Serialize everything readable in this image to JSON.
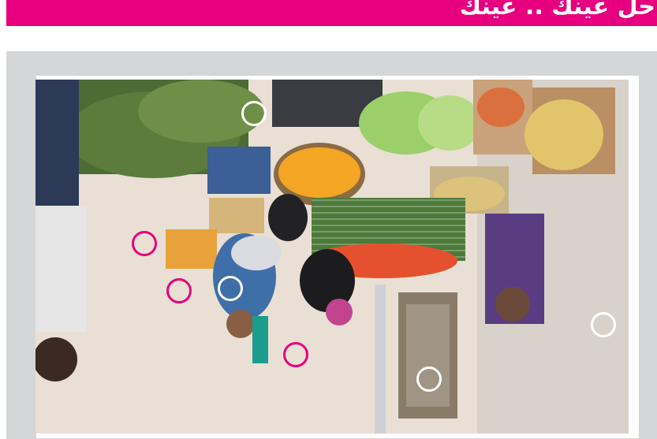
{
  "header": {
    "title": "حل عينك .. عينك",
    "color": "#e6007e"
  },
  "puzzle": {
    "found_marker_color": "#e6007e",
    "unfound_marker_color": "#ffffff",
    "differences": [
      {
        "id": 1,
        "found": false
      },
      {
        "id": 2,
        "found": true
      },
      {
        "id": 3,
        "found": true
      },
      {
        "id": 4,
        "found": false
      },
      {
        "id": 5,
        "found": true
      },
      {
        "id": 6,
        "found": false
      },
      {
        "id": 7,
        "found": false
      }
    ]
  }
}
